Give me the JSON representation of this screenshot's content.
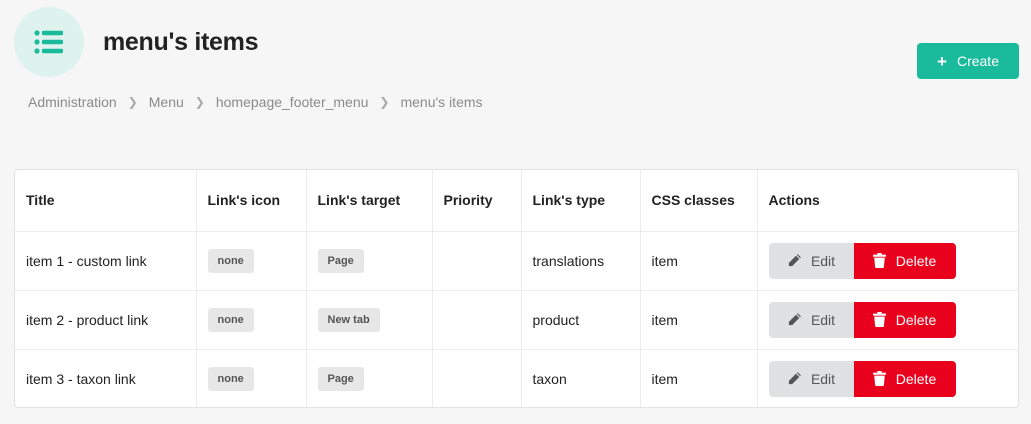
{
  "header": {
    "title": "menu's items",
    "icon": "list-icon",
    "accent_color": "#1abb9c",
    "create_label": "Create"
  },
  "breadcrumb": [
    "Administration",
    "Menu",
    "homepage_footer_menu",
    "menu's items"
  ],
  "table": {
    "columns": [
      "Title",
      "Link's icon",
      "Link's target",
      "Priority",
      "Link's type",
      "CSS classes",
      "Actions"
    ],
    "rows": [
      {
        "title": "item 1 - custom link",
        "icon": "none",
        "target": "Page",
        "priority": "",
        "type": "translations",
        "css": "item"
      },
      {
        "title": "item 2 - product link",
        "icon": "none",
        "target": "New tab",
        "priority": "",
        "type": "product",
        "css": "item"
      },
      {
        "title": "item 3 - taxon link",
        "icon": "none",
        "target": "Page",
        "priority": "",
        "type": "taxon",
        "css": "item"
      }
    ],
    "edit_label": "Edit",
    "delete_label": "Delete",
    "delete_color": "#e8001c"
  }
}
